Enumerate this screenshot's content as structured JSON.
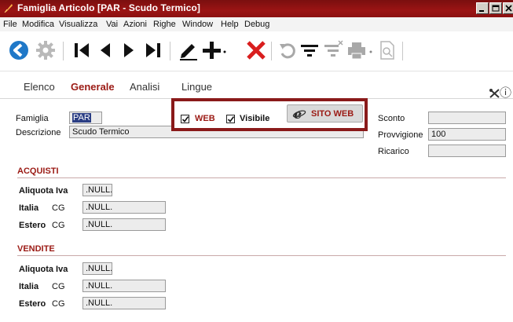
{
  "window": {
    "title": "Famiglia Articolo [PAR - Scudo Termico]"
  },
  "menu": [
    "File",
    "Modifica",
    "Visualizza",
    "Vai",
    "Azioni",
    "Righe",
    "Window",
    "Help",
    "Debug"
  ],
  "tabs": [
    "Elenco",
    "Generale",
    "Analisi",
    "Lingue"
  ],
  "active_tab": "Generale",
  "form": {
    "famiglia_label": "Famiglia",
    "famiglia_value": "PAR",
    "descrizione_label": "Descrizione",
    "descrizione_value": "Scudo Termico",
    "web_label": "WEB",
    "web_checked": true,
    "visibile_label": "Visibile",
    "visibile_checked": true,
    "sito_web_label": "SITO WEB",
    "sconto_label": "Sconto",
    "sconto_value": "",
    "provvigione_label": "Provvigione",
    "provvigione_value": "100",
    "ricarico_label": "Ricarico",
    "ricarico_value": ""
  },
  "acquisti": {
    "title": "ACQUISTI",
    "aliquota_label": "Aliquota Iva",
    "aliquota_value": ".NULL.",
    "italia_label": "Italia",
    "italia_cg": "CG",
    "italia_value": ".NULL.",
    "estero_label": "Estero",
    "estero_cg": "CG",
    "estero_value": ".NULL."
  },
  "vendite": {
    "title": "VENDITE",
    "aliquota_label": "Aliquota Iva",
    "aliquota_value": ".NULL.",
    "italia_label": "Italia",
    "italia_cg": "CG",
    "italia_value": ".NULL.",
    "estero_label": "Estero",
    "estero_cg": "CG",
    "estero_value": ".NULL."
  },
  "colors": {
    "accent": "#9b1a14",
    "titlebar": "#8b1010",
    "toolbar_blue": "#1f78c8"
  },
  "icons": [
    "app-feather-icon",
    "back-circle-icon",
    "gear-icon",
    "first-record-icon",
    "previous-record-icon",
    "next-record-icon",
    "last-record-icon",
    "edit-icon",
    "add-icon",
    "delete-icon",
    "undo-icon",
    "filter-icon",
    "clear-filter-icon",
    "print-icon",
    "preview-icon",
    "tools-icon",
    "info-icon",
    "ie-globe-icon"
  ]
}
